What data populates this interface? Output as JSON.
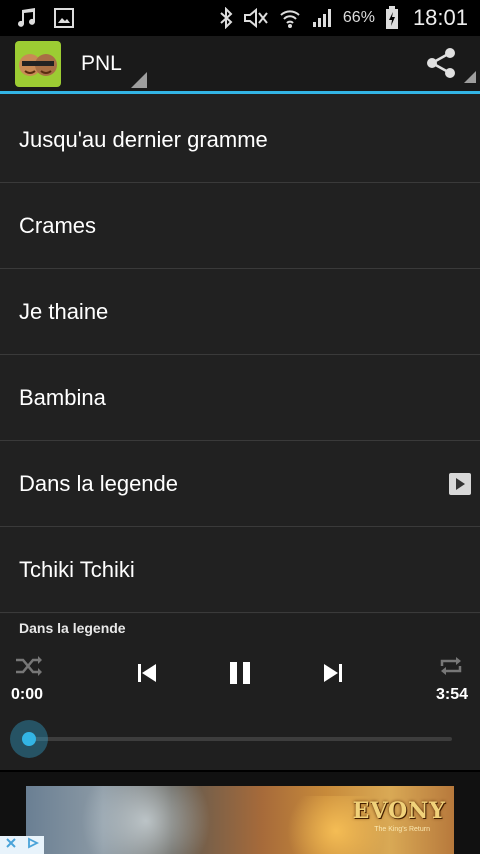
{
  "status_bar": {
    "battery_percent": "66%",
    "time": "18:01"
  },
  "action_bar": {
    "title": "PNL",
    "share_icon": "share-icon"
  },
  "songs": [
    {
      "label": "Jusqu'au dernier gramme",
      "playing": false
    },
    {
      "label": "Crames",
      "playing": false
    },
    {
      "label": "Je thaine",
      "playing": false
    },
    {
      "label": "Bambina",
      "playing": false
    },
    {
      "label": "Dans la legende",
      "playing": true
    },
    {
      "label": "Tchiki Tchiki",
      "playing": false
    }
  ],
  "player": {
    "now_playing": "Dans la legende",
    "current_time": "0:00",
    "total_time": "3:54",
    "progress": 0
  },
  "ad": {
    "brand": "EVONY",
    "sub": "The King's Return"
  },
  "colors": {
    "accent": "#33b5e5",
    "background": "#212121"
  }
}
